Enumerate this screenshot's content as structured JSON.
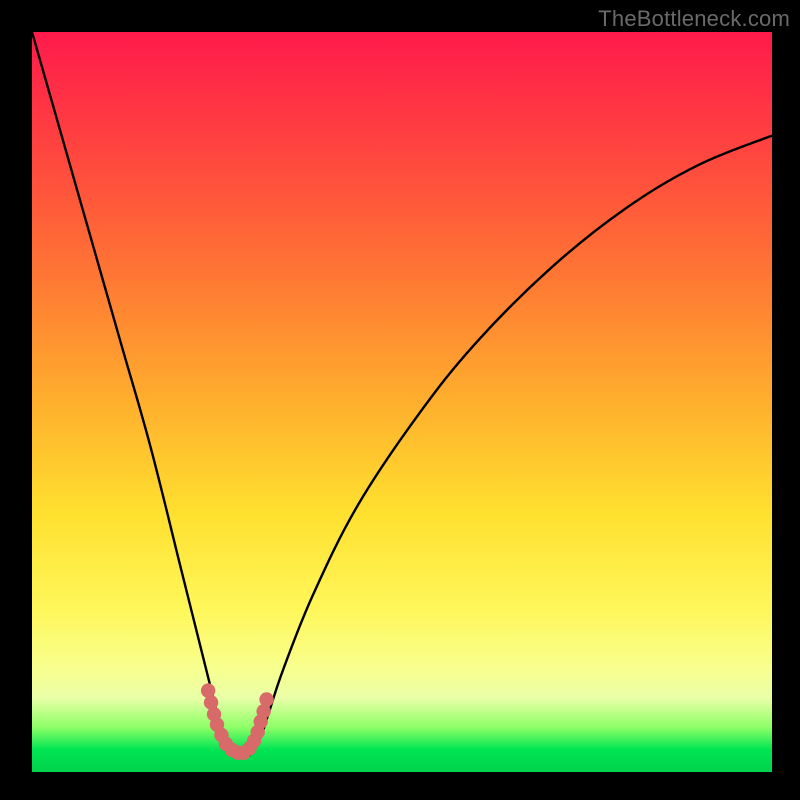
{
  "watermark": "TheBottleneck.com",
  "chart_data": {
    "type": "line",
    "title": "",
    "xlabel": "",
    "ylabel": "",
    "xlim": [
      0,
      100
    ],
    "ylim": [
      0,
      100
    ],
    "grid": false,
    "legend": false,
    "series": [
      {
        "name": "bottleneck-curve",
        "x": [
          0,
          4,
          8,
          12,
          16,
          20,
          22,
          24,
          25,
          26,
          27,
          28,
          29,
          30,
          31,
          32,
          34,
          38,
          44,
          52,
          60,
          70,
          80,
          90,
          100
        ],
        "values": [
          100,
          86,
          72,
          58,
          44,
          28,
          20,
          12,
          8,
          5,
          3,
          2,
          2,
          3,
          5,
          8,
          14,
          24,
          36,
          48,
          58,
          68,
          76,
          82,
          86
        ]
      },
      {
        "name": "highlight-dots",
        "x": [
          23.8,
          24.2,
          24.6,
          25.0,
          25.6,
          26.2,
          27.0,
          27.8,
          28.6,
          29.4,
          30.0,
          30.5,
          30.9,
          31.3,
          31.7
        ],
        "values": [
          11.0,
          9.4,
          7.8,
          6.4,
          5.0,
          3.8,
          3.0,
          2.6,
          2.6,
          3.2,
          4.2,
          5.4,
          6.8,
          8.2,
          9.8
        ]
      }
    ],
    "background_gradient": {
      "direction": "vertical",
      "stops": [
        {
          "pos": 0,
          "color": "#ff1a4b"
        },
        {
          "pos": 34,
          "color": "#ff7a33"
        },
        {
          "pos": 65,
          "color": "#ffe02f"
        },
        {
          "pos": 86,
          "color": "#f8ff8e"
        },
        {
          "pos": 97,
          "color": "#00e552"
        },
        {
          "pos": 100,
          "color": "#00d24b"
        }
      ]
    },
    "curve_color": "#000000",
    "highlight_color": "#d86a6a"
  }
}
